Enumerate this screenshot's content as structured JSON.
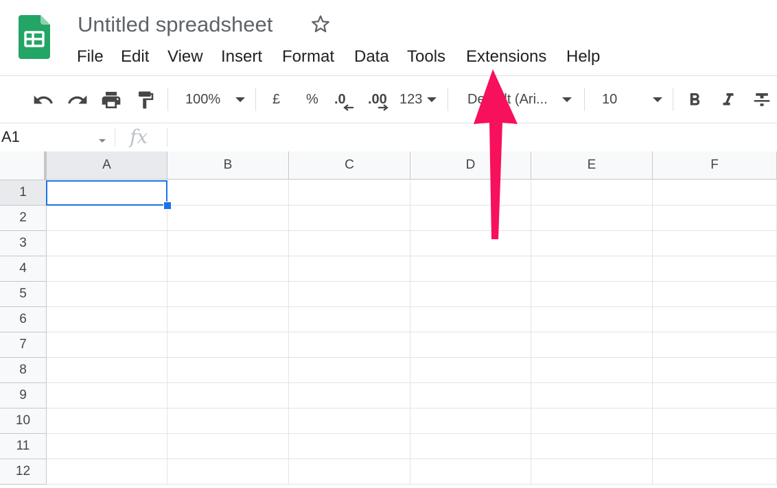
{
  "header": {
    "title": "Untitled spreadsheet",
    "logo_icon": "sheets-logo-icon",
    "star_icon": "star-outline-icon"
  },
  "menu": {
    "items": [
      "File",
      "Edit",
      "View",
      "Insert",
      "Format",
      "Data",
      "Tools",
      "Extensions",
      "Help"
    ]
  },
  "toolbar": {
    "icons": [
      "undo-icon",
      "redo-icon",
      "print-icon",
      "paint-format-icon"
    ],
    "zoom": "100%",
    "currency": "£",
    "percent": "%",
    "decrease_decimal": ".0",
    "increase_decimal": ".00",
    "more_formats": "123",
    "font": "Default (Ari...",
    "font_size": "10",
    "style_icons": [
      "bold-icon",
      "italic-icon",
      "strikethrough-icon"
    ]
  },
  "formula_bar": {
    "name_box": "A1",
    "fx": "fx",
    "value": ""
  },
  "grid": {
    "columns": [
      "A",
      "B",
      "C",
      "D",
      "E",
      "F"
    ],
    "rows": [
      "1",
      "2",
      "3",
      "4",
      "5",
      "6",
      "7",
      "8",
      "9",
      "10",
      "11",
      "12"
    ],
    "selected_cell": "A1"
  },
  "colors": {
    "sheets_green": "#23a566",
    "selection_blue": "#1a73e8",
    "annotation_arrow": "#f7105c"
  }
}
